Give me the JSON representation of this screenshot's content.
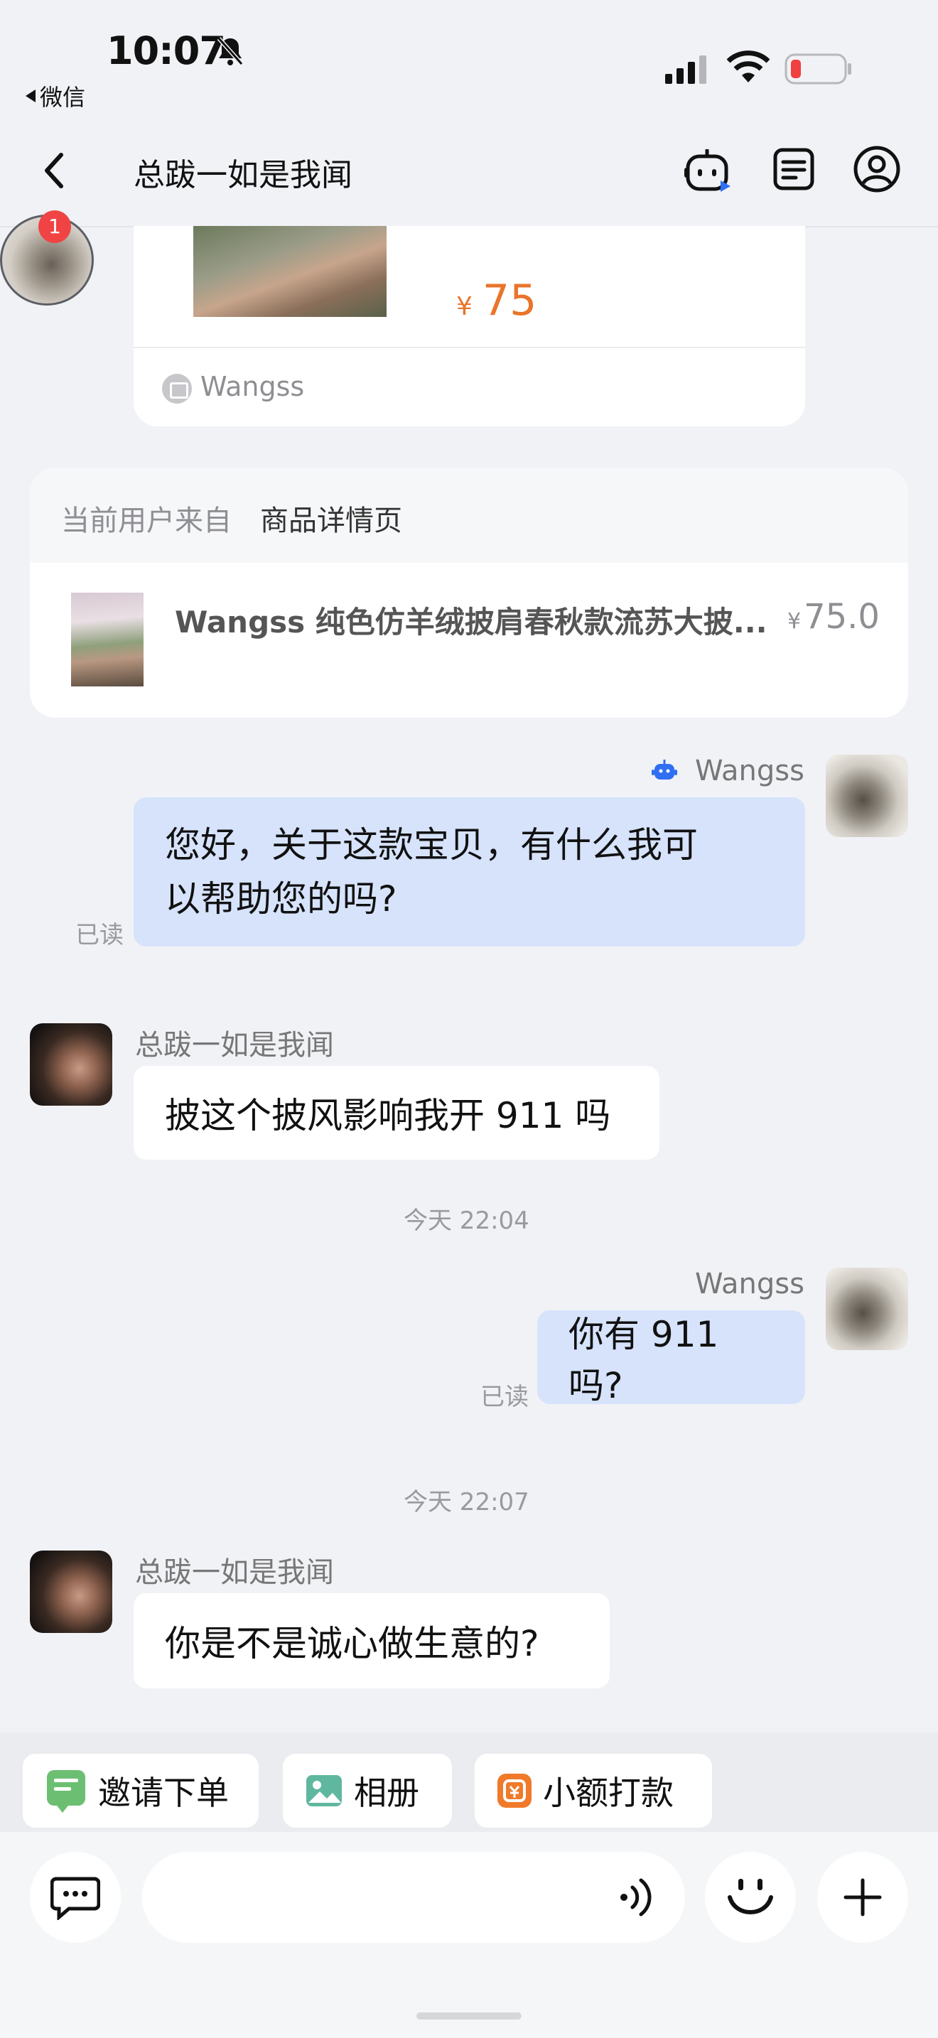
{
  "status_bar": {
    "time": "10:07",
    "back_app": "微信"
  },
  "header": {
    "title": "总跋一如是我闻"
  },
  "badge_count": "1",
  "product_card": {
    "currency": "¥",
    "price": "75",
    "shop": "Wangss"
  },
  "source_card": {
    "from_label": "当前用户来自",
    "page": "商品详情页",
    "title": "Wangss 纯色仿羊绒披肩春秋款流苏大披...",
    "currency": "¥",
    "price": "75.0"
  },
  "messages": [
    {
      "sender": "Wangss",
      "text_line1": "您好，关于这款宝贝，有什么我可",
      "text_line2": "以帮助您的吗?",
      "read": "已读"
    },
    {
      "sender": "总跋一如是我闻",
      "text": "披这个披风影响我开 911 吗"
    },
    {
      "time": "今天 22:04"
    },
    {
      "sender": "Wangss",
      "text": "你有 911 吗?",
      "read": "已读"
    },
    {
      "time": "今天 22:07"
    },
    {
      "sender": "总跋一如是我闻",
      "text": "你是不是诚心做生意的?"
    }
  ],
  "tools": {
    "invite": "邀请下单",
    "album": "相册",
    "transfer": "小额打款"
  },
  "colors": {
    "my_bubble": "#d6e3fb",
    "price": "#e9742b",
    "background": "#f1f2f6"
  }
}
